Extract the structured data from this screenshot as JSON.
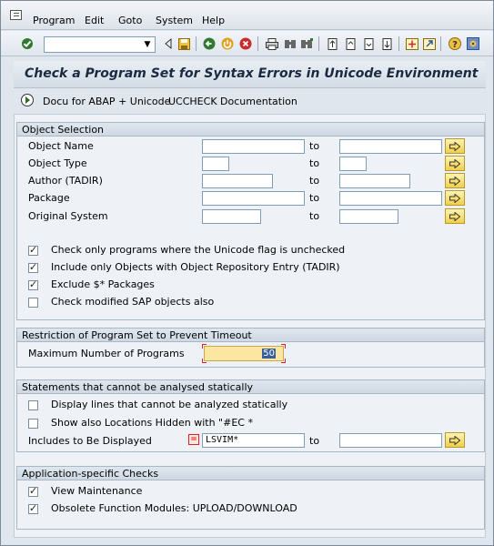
{
  "menu": {
    "items": [
      {
        "label": "Program"
      },
      {
        "label": "Edit"
      },
      {
        "label": "Goto"
      },
      {
        "label": "System"
      },
      {
        "label": "Help"
      }
    ]
  },
  "toolbar": {
    "command_field_value": ""
  },
  "screen": {
    "title": "Check a Program Set for Syntax Errors in Unicode Environment"
  },
  "app_toolbar": {
    "docu_label": "Docu for ABAP + Unicode",
    "ucc_label": "UCCHECK Documentation"
  },
  "object_selection": {
    "title": "Object Selection",
    "to_label": "to",
    "rows": [
      {
        "label": "Object Name",
        "from": "",
        "to": ""
      },
      {
        "label": "Object Type",
        "from": "",
        "to": ""
      },
      {
        "label": "Author (TADIR)",
        "from": "",
        "to": ""
      },
      {
        "label": "Package",
        "from": "",
        "to": ""
      },
      {
        "label": "Original System",
        "from": "",
        "to": ""
      }
    ],
    "checks": [
      {
        "label": "Check only programs where the Unicode flag is unchecked",
        "checked": true
      },
      {
        "label": "Include only Objects with Object Repository Entry (TADIR)",
        "checked": true
      },
      {
        "label": "Exclude $* Packages",
        "checked": true
      },
      {
        "label": "Check modified SAP objects also",
        "checked": false
      }
    ]
  },
  "restriction": {
    "title": "Restriction of Program Set to Prevent Timeout",
    "max_label": "Maximum Number of Programs",
    "max_value": "50"
  },
  "statements": {
    "title": "Statements that cannot be analysed statically",
    "checks": [
      {
        "label": "Display lines that cannot be analyzed statically",
        "checked": false
      },
      {
        "label": "Show also Locations Hidden with \"#EC *",
        "checked": false
      }
    ],
    "include_label": "Includes to Be Displayed",
    "include_value": "LSVIM*",
    "to_label": "to",
    "include_to": ""
  },
  "app_checks": {
    "title": "Application-specific Checks",
    "checks": [
      {
        "label": "View Maintenance",
        "checked": true
      },
      {
        "label": "Obsolete Function Modules: UPLOAD/DOWNLOAD",
        "checked": true
      }
    ]
  }
}
